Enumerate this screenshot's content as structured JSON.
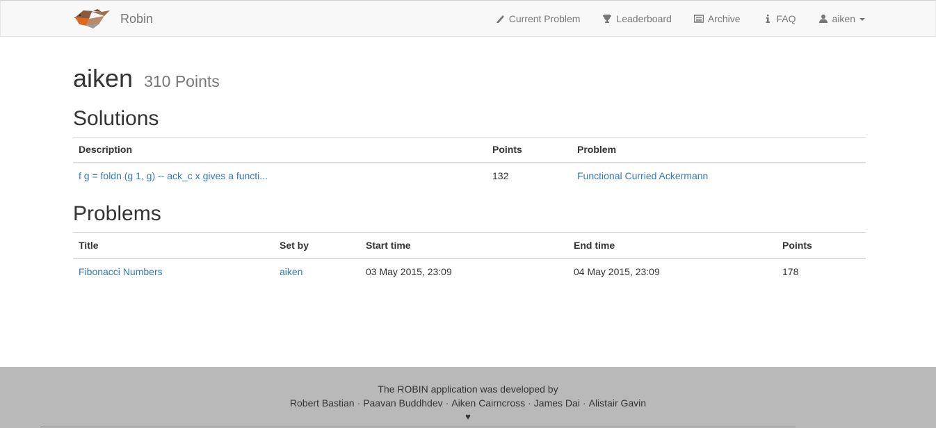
{
  "brand": {
    "name": "Robin",
    "logo": "robin-bird-logo"
  },
  "nav": {
    "items": [
      {
        "label": "Current Problem",
        "icon": "pencil-icon"
      },
      {
        "label": "Leaderboard",
        "icon": "trophy-icon"
      },
      {
        "label": "Archive",
        "icon": "list-alt-icon"
      },
      {
        "label": "FAQ",
        "icon": "info-icon"
      },
      {
        "label": "aiken",
        "icon": "user-icon"
      }
    ]
  },
  "profile": {
    "username": "aiken",
    "points": "310 Points"
  },
  "solutions": {
    "heading": "Solutions",
    "columns": [
      "Description",
      "Points",
      "Problem"
    ],
    "rows": [
      {
        "description": "f g = foldn (g 1, g) -- ack_c x gives a functi...",
        "points": "132",
        "problem": "Functional Curried Ackermann"
      }
    ]
  },
  "problems": {
    "heading": "Problems",
    "columns": [
      "Title",
      "Set by",
      "Start time",
      "End time",
      "Points"
    ],
    "rows": [
      {
        "title": "Fibonacci Numbers",
        "set_by": "aiken",
        "start": "03 May 2015, 23:09",
        "end": "04 May 2015, 23:09",
        "points": "178"
      }
    ]
  },
  "footer": {
    "line1": "The ROBIN application was developed by",
    "developers": [
      "Robert Bastian",
      "Paavan Buddhdev",
      "Aiken Cairncross",
      "James Dai",
      "Alistair Gavin"
    ],
    "separator": "·",
    "heart": "♥"
  },
  "colors": {
    "link": "#337ab7",
    "navbar_bg": "#f8f8f8",
    "footer_bg": "#b9b9b9",
    "muted": "#777777"
  }
}
